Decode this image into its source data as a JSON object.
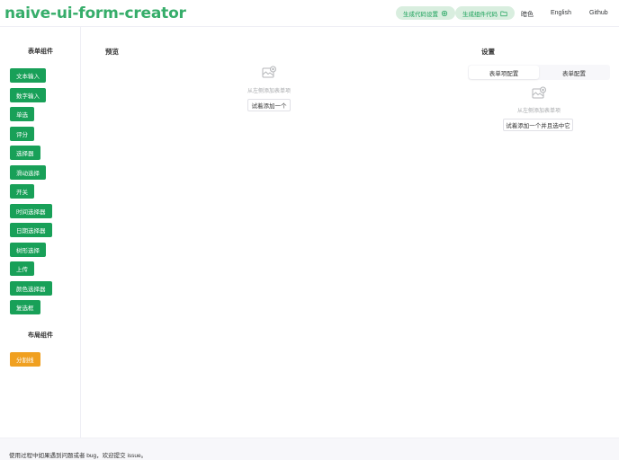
{
  "header": {
    "logo": "naive-ui-form-creator",
    "gen_code_settings": "生成代码设置",
    "gen_component_code": "生成组件代码",
    "theme": "暗色",
    "language": "English",
    "github": "Github"
  },
  "sidebar": {
    "form_components_title": "表单组件",
    "form_components": [
      "文本输入",
      "数字输入",
      "单选",
      "评分",
      "选择器",
      "滑动选择",
      "开关",
      "时间选择器",
      "日期选择器",
      "树形选择",
      "上传",
      "颜色选择器",
      "复选框"
    ],
    "layout_components_title": "布局组件",
    "layout_components": [
      "分割线"
    ]
  },
  "preview": {
    "title": "预览",
    "empty_text": "从左侧添加表单项",
    "try_button": "试着添加一个"
  },
  "settings": {
    "title": "设置",
    "tabs": [
      "表单项配置",
      "表单配置"
    ],
    "active_tab": "表单项配置",
    "empty_text": "从左侧添加表单项",
    "try_button": "试着添加一个并且选中它"
  },
  "footer": {
    "text": "使用过程中如果遇到问题或者 bug，欢迎提交 issue。"
  },
  "colors": {
    "primary": "#18a058",
    "primary_light": "#d9eedf",
    "warning": "#f0a020",
    "logo": "#36ad6a"
  }
}
